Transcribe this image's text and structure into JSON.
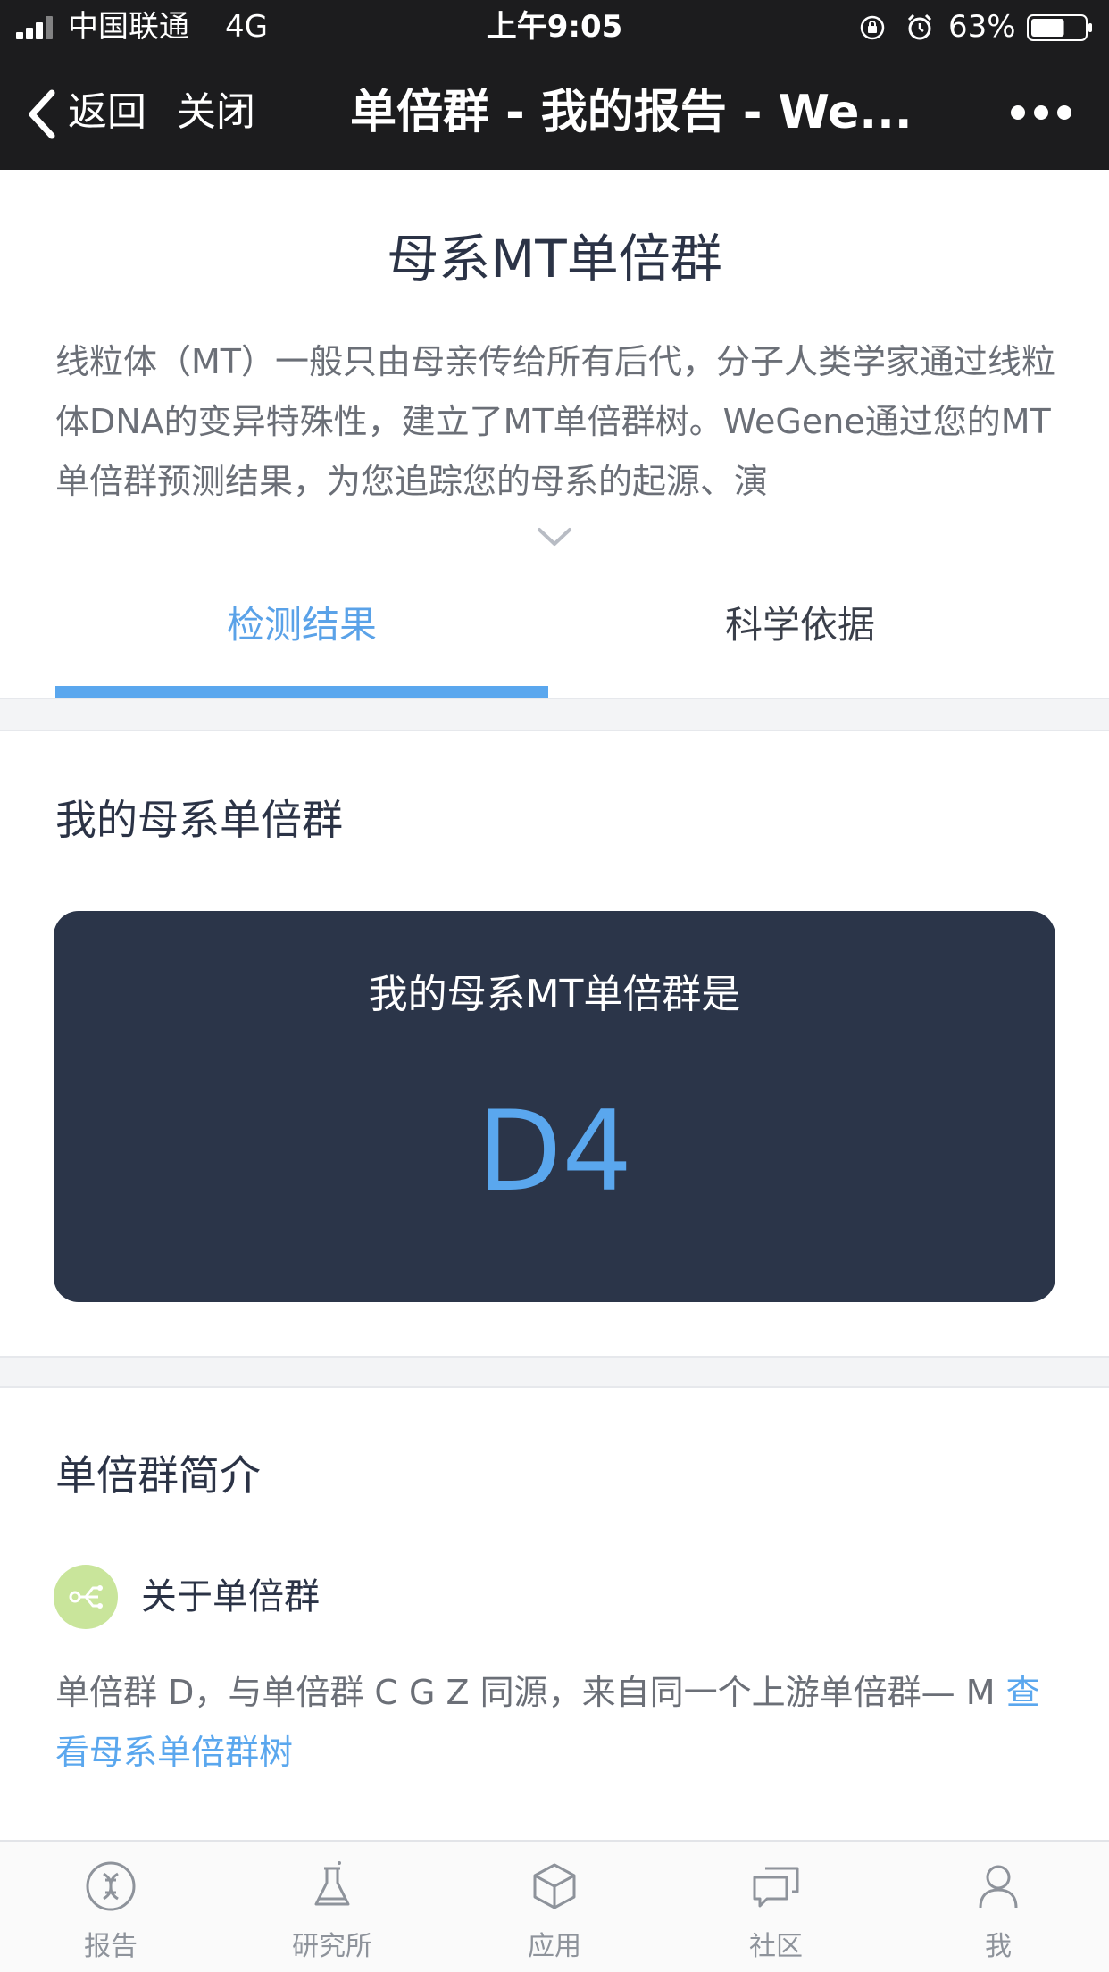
{
  "status_bar": {
    "carrier": "中国联通",
    "network": "4G",
    "time": "上午9:05",
    "battery": "63%",
    "battery_level": 0.63
  },
  "nav": {
    "back_label": "返回",
    "close_label": "关闭",
    "title": "单倍群 - 我的报告 - We..."
  },
  "header": {
    "title": "母系MT单倍群",
    "description": "线粒体（MT）一般只由母亲传给所有后代，分子人类学家通过线粒体DNA的变异特殊性，建立了MT单倍群树。WeGene通过您的MT单倍群预测结果，为您追踪您的母系的起源、演"
  },
  "tabs": [
    {
      "label": "检测结果",
      "active": true
    },
    {
      "label": "科学依据",
      "active": false
    }
  ],
  "result": {
    "heading": "我的母系单倍群",
    "caption": "我的母系MT单倍群是",
    "value": "D4"
  },
  "intro_section": {
    "heading": "单倍群简介",
    "about_label": "关于单倍群",
    "text": "单倍群 D，与单倍群 C G Z 同源，来自同一个上游单倍群— M ",
    "link": "查看母系单倍群树"
  },
  "tabbar": [
    {
      "label": "报告",
      "icon": "dna-report-icon"
    },
    {
      "label": "研究所",
      "icon": "flask-icon"
    },
    {
      "label": "应用",
      "icon": "cube-icon"
    },
    {
      "label": "社区",
      "icon": "chat-bubbles-icon"
    },
    {
      "label": "我",
      "icon": "person-icon"
    }
  ],
  "colors": {
    "accent": "#5aa7ee",
    "card_bg": "#2b3549",
    "nav_bg": "#1c1c1e",
    "about_icon_bg": "#c9e59b"
  }
}
